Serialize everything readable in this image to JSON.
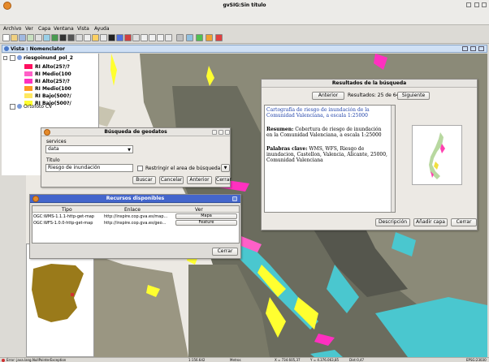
{
  "app": {
    "title": "gvSIG:Sin título"
  },
  "menu": [
    "Archivo",
    "Ver",
    "Capa",
    "Ventana",
    "Vista",
    "Ayuda"
  ],
  "view": {
    "title": "Vista : Nomenclator"
  },
  "toc": {
    "group_name": "riesgoinund_pol_2",
    "legend": [
      {
        "label": "RI Alto(25?/?",
        "color": "#ff1060"
      },
      {
        "label": "RI Medio(100",
        "color": "#ff60c8"
      },
      {
        "label": "RI Alto(25?/?",
        "color": "#ff30c0"
      },
      {
        "label": "RI Medio(100",
        "color": "#ff9a20"
      },
      {
        "label": "RI Bajo(500?/",
        "color": "#ffe860"
      },
      {
        "label": "RI Bajo(500?/",
        "color": "#ffff30"
      }
    ],
    "layer2": "Ortofoto CV"
  },
  "search_dialog": {
    "title": "Búsqueda de geodatos",
    "services_label": "services",
    "services_value": "data",
    "titulo_label": "Titulo",
    "titulo_value": "Riesgo de inundación",
    "restrict_label": "Restringir el area de búsqueda",
    "buttons": {
      "buscar": "Buscar",
      "cancelar": "Cancelar",
      "anterior": "Anterior",
      "cerrar": "Cerrar"
    }
  },
  "results": {
    "title": "Resultados de la búsqueda",
    "anterior": "Anterior",
    "resultados": "Resultados: 25 de 64",
    "siguiente": "Siguiente",
    "heading": "Cartografía de riesgo de inundación de la Comunidad Valenciana, a escala 1:25000",
    "resumen_label": "Resumen:",
    "resumen_text": "Cobertura de riesgo de inundación en la Comunidad Valenciana, a escala 1:25000",
    "palabras_label": "Palabras clave:",
    "palabras_text": "WMS, WFS, Riesgo de inundacion, Castellon, Valencia, Alicante, 25000, Comunidad Valenciana",
    "buttons": {
      "descripcion": "Descripción",
      "anadir": "Añadir capa",
      "cerrar": "Cerrar"
    }
  },
  "resources": {
    "title": "Recursos disponibles",
    "columns": [
      "Tipo",
      "Enlace",
      "Ver"
    ],
    "rows": [
      {
        "tipo": "OGC:WMS-1.1.1-http-get-map",
        "enlace": "http://inspire.cop.gva.es/map...",
        "ver": "Mapa"
      },
      {
        "tipo": "OGC:WFS-1.0.0-http-get-map",
        "enlace": "http://inspire.cop.gva.es/geo...",
        "ver": "Feature"
      }
    ],
    "cerrar": "Cerrar"
  },
  "status": {
    "error": "Error: java.lang.NullPointerException",
    "scale": "1:156.642",
    "units": "Metros",
    "x": "X = 734.605,37",
    "y": "Y = 4.376.063,85",
    "dist": "Dist:0,47",
    "epsg": "EPSG:23030"
  }
}
